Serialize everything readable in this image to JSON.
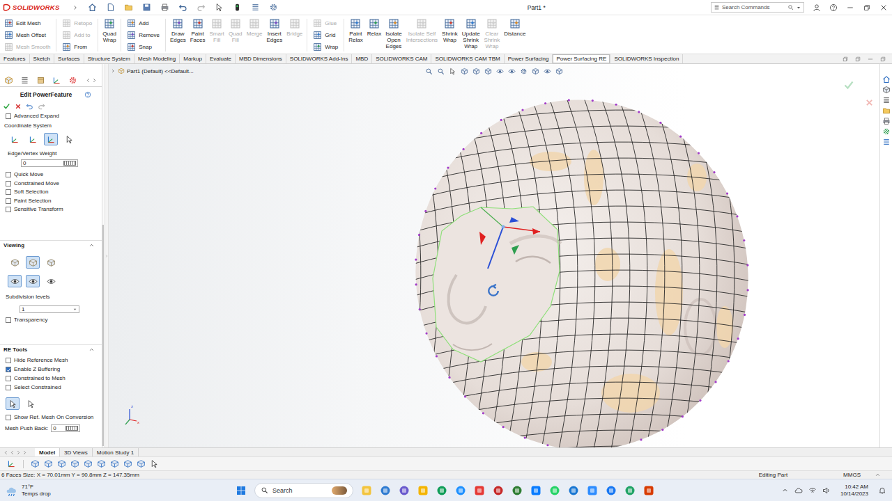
{
  "app": {
    "logo": "SOLIDWORKS",
    "title": "Part1 *",
    "search_placeholder": "Search Commands"
  },
  "ribbon": [
    {
      "kind": "stack",
      "items": [
        {
          "label": "Edit Mesh",
          "disabled": false
        },
        {
          "label": "Mesh Offset",
          "disabled": false
        },
        {
          "label": "Mesh Smooth",
          "disabled": true
        }
      ]
    },
    {
      "kind": "stack",
      "items": [
        {
          "label": "Retopo",
          "disabled": true
        },
        {
          "label": "Add to",
          "disabled": true
        },
        {
          "label": "From",
          "disabled": false
        }
      ]
    },
    {
      "kind": "big",
      "items": [
        {
          "lines": [
            "Quad",
            "Wrap"
          ],
          "disabled": false
        }
      ]
    },
    {
      "kind": "stack",
      "items": [
        {
          "label": "Add",
          "disabled": false
        },
        {
          "label": "Remove",
          "disabled": false
        },
        {
          "label": "Snap",
          "disabled": false
        }
      ]
    },
    {
      "kind": "big",
      "items": [
        {
          "lines": [
            "Draw",
            "Edges"
          ],
          "disabled": false
        },
        {
          "lines": [
            "Paint",
            "Faces"
          ],
          "disabled": false
        },
        {
          "lines": [
            "Smart",
            "Fill"
          ],
          "disabled": true
        },
        {
          "lines": [
            "Quad",
            "Fill"
          ],
          "disabled": true
        },
        {
          "lines": [
            "Merge"
          ],
          "disabled": true
        },
        {
          "lines": [
            "Insert",
            "Edges"
          ],
          "disabled": false
        },
        {
          "lines": [
            "Bridge"
          ],
          "disabled": true
        }
      ]
    },
    {
      "kind": "stack",
      "items": [
        {
          "label": "Glue",
          "disabled": true
        },
        {
          "label": "Grid",
          "disabled": false
        },
        {
          "label": "Wrap",
          "disabled": false
        }
      ]
    },
    {
      "kind": "big",
      "items": [
        {
          "lines": [
            "Paint",
            "Relax"
          ],
          "disabled": false
        },
        {
          "lines": [
            "Relax"
          ],
          "disabled": false
        },
        {
          "lines": [
            "Isolate",
            "Open",
            "Edges"
          ],
          "disabled": false
        },
        {
          "lines": [
            "Isolate Self",
            "Intersections"
          ],
          "disabled": true
        },
        {
          "lines": [
            "Shrink",
            "Wrap"
          ],
          "disabled": false
        },
        {
          "lines": [
            "Update",
            "Shrink",
            "Wrap"
          ],
          "disabled": false
        },
        {
          "lines": [
            "Clear",
            "Shrink",
            "Wrap"
          ],
          "disabled": true
        },
        {
          "lines": [
            "Distance"
          ],
          "disabled": false
        }
      ]
    }
  ],
  "tabs": [
    {
      "label": "Features",
      "selected": false
    },
    {
      "label": "Sketch",
      "selected": false
    },
    {
      "label": "Surfaces",
      "selected": false
    },
    {
      "label": "Structure System",
      "selected": false
    },
    {
      "label": "Mesh Modeling",
      "selected": false
    },
    {
      "label": "Markup",
      "selected": false
    },
    {
      "label": "Evaluate",
      "selected": false
    },
    {
      "label": "MBD Dimensions",
      "selected": false
    },
    {
      "label": "SOLIDWORKS Add-Ins",
      "selected": false
    },
    {
      "label": "MBD",
      "selected": false
    },
    {
      "label": "SOLIDWORKS CAM",
      "selected": false
    },
    {
      "label": "SOLIDWORKS CAM TBM",
      "selected": false
    },
    {
      "label": "Power Surfacing",
      "selected": false
    },
    {
      "label": "Power Surfacing RE",
      "selected": true
    },
    {
      "label": "SOLIDWORKS Inspection",
      "selected": false
    }
  ],
  "feature_tree": {
    "label": "Part1 (Default) <<Default..."
  },
  "property_manager": {
    "title": "Edit PowerFeature",
    "cut_option": {
      "label": "Advanced Expand",
      "checked": false
    },
    "coordinate_system": {
      "label": "Coordinate System",
      "modes": [
        {
          "selected": false
        },
        {
          "selected": false
        },
        {
          "selected": true
        },
        {
          "selected": false
        }
      ]
    },
    "weight": {
      "label": "Edge/Vertex Weight",
      "value": "0"
    },
    "options": [
      {
        "label": "Quick Move",
        "checked": false
      },
      {
        "label": "Constrained Move",
        "checked": false
      },
      {
        "label": "Soft Selection",
        "checked": false
      },
      {
        "label": "Paint Selection",
        "checked": false
      },
      {
        "label": "Sensitive Transform",
        "checked": false
      }
    ],
    "viewing": {
      "title": "Viewing",
      "expanded": true,
      "display_modes": [
        {
          "selected": false
        },
        {
          "selected": true
        },
        {
          "selected": false
        }
      ],
      "view_modes": [
        {
          "selected": true
        },
        {
          "selected": true
        },
        {
          "selected": false
        }
      ],
      "subdivision": {
        "label": "Subdivision levels",
        "value": "1"
      },
      "transparency": {
        "label": "Transparency",
        "checked": false
      }
    },
    "re_tools": {
      "title": "RE Tools",
      "expanded": true,
      "options": [
        {
          "label": "Hide Reference Mesh",
          "checked": false
        },
        {
          "label": "Enable Z Buffering",
          "checked": true
        },
        {
          "label": "Constrained to Mesh",
          "checked": false
        },
        {
          "label": "Select Constrained",
          "checked": false
        }
      ],
      "modes": [
        {
          "selected": true
        },
        {
          "selected": false
        }
      ],
      "show_ref": {
        "label": "Show Ref. Mesh On Conversion",
        "checked": false
      },
      "push_back": {
        "label": "Mesh Push Back:",
        "value": "0"
      }
    }
  },
  "triad_labels": [
    "z",
    "x"
  ],
  "bottom_tabs": [
    {
      "label": "Model",
      "selected": true
    },
    {
      "label": "3D Views",
      "selected": false
    },
    {
      "label": "Motion Study 1",
      "selected": false
    }
  ],
  "status_bar": {
    "info": "6 Faces Size: X = 70.01mm Y = 90.8mm Z = 147.35mm",
    "mode": "Editing Part",
    "units": "MMGS"
  },
  "taskbar": {
    "weather": {
      "temp": "71°F",
      "note": "Temps drop"
    },
    "search_placeholder": "Search",
    "time": "10:42 AM",
    "date": "10/14/2023"
  }
}
